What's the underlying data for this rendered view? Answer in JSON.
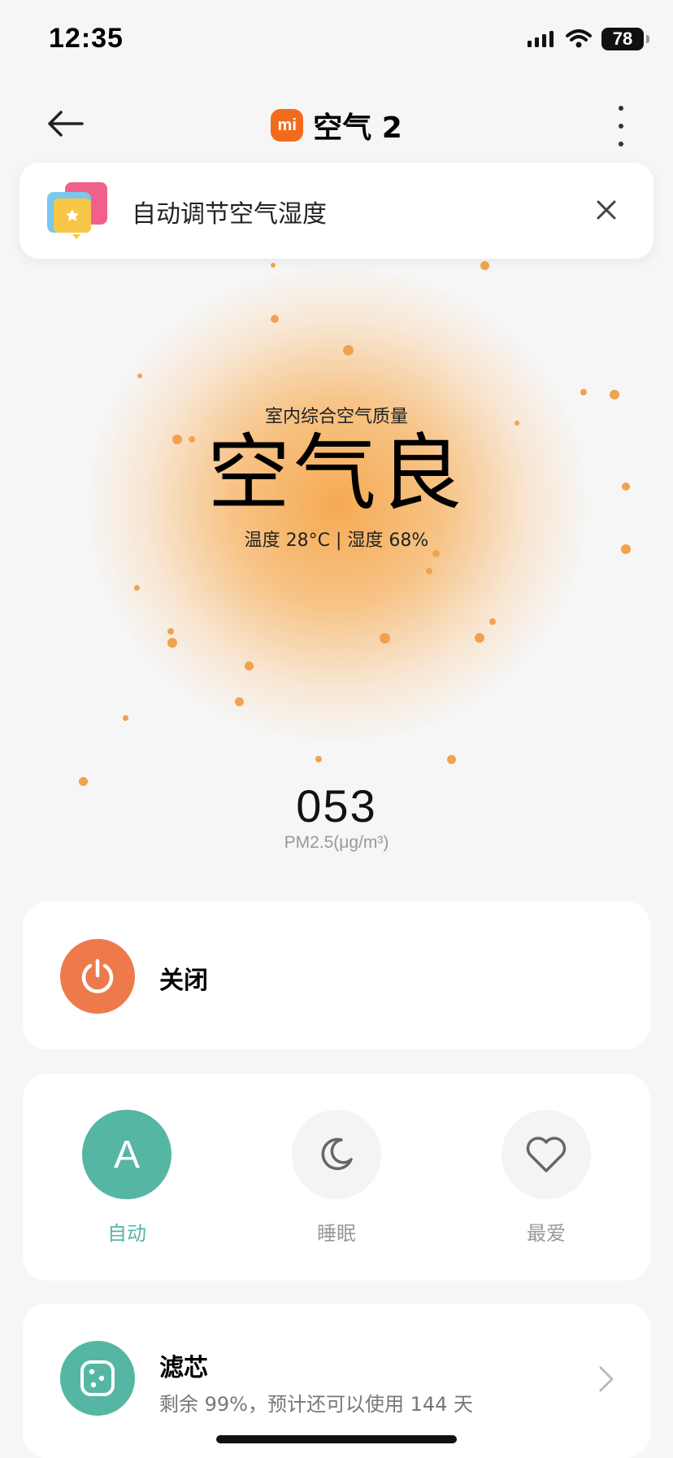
{
  "status_bar": {
    "time": "12:35",
    "battery": "78"
  },
  "header": {
    "brand_logo": "mi",
    "title": "空气 2",
    "back_icon": "arrow-left-icon",
    "more_icon": "more-vertical-icon"
  },
  "tip": {
    "text": "自动调节空气湿度",
    "icon": "star-chat-icon",
    "close_icon": "close-icon"
  },
  "air_quality": {
    "label": "室内综合空气质量",
    "value": "空气良",
    "detail": "温度 28°C | 湿度 68%",
    "glow_color": "#f6a64a"
  },
  "pm": {
    "value": "053",
    "unit": "PM2.5(μg/m³)"
  },
  "power": {
    "label": "关闭",
    "icon": "power-icon",
    "color": "#ee7a4c"
  },
  "modes": [
    {
      "label": "自动",
      "icon": "auto-A-icon",
      "glyph": "A",
      "active": true
    },
    {
      "label": "睡眠",
      "icon": "moon-icon",
      "active": false
    },
    {
      "label": "最爱",
      "icon": "heart-icon",
      "active": false
    }
  ],
  "filter": {
    "title": "滤芯",
    "description": "剩余 99%，预计还可以使用 144 天",
    "icon": "filter-icon",
    "chevron_icon": "chevron-right-icon"
  },
  "colors": {
    "accent_green": "#55b6a3",
    "accent_orange": "#ee7a4c"
  }
}
